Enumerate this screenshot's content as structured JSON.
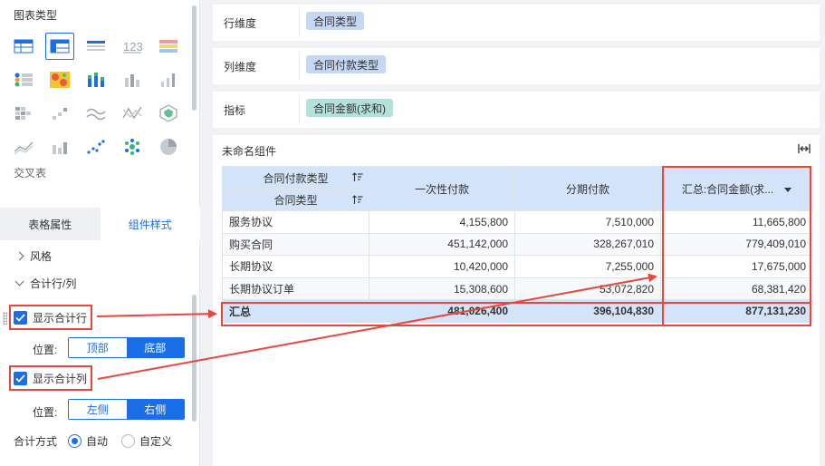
{
  "left_panel": {
    "chart_type_title": "图表类型",
    "chart_icons": [
      {
        "icon": "table-icon",
        "selected": false
      },
      {
        "icon": "crosstab-icon",
        "selected": true
      },
      {
        "icon": "detail-table-icon",
        "selected": false
      },
      {
        "icon": "number-card-icon",
        "text": "123",
        "selected": false
      },
      {
        "icon": "color-table-icon",
        "selected": false
      },
      {
        "icon": "kpi-list-icon",
        "selected": false
      },
      {
        "icon": "heatmap-icon",
        "selected": false
      },
      {
        "icon": "stacked-bar-icon",
        "selected": false
      },
      {
        "icon": "bar-chart-icon",
        "selected": false
      },
      {
        "icon": "column-chart-icon",
        "selected": false
      },
      {
        "icon": "pixel-grid-icon",
        "selected": false
      },
      {
        "icon": "step-line-icon",
        "selected": false
      },
      {
        "icon": "wave-line-icon",
        "selected": false
      },
      {
        "icon": "cross-line-icon",
        "selected": false
      },
      {
        "icon": "radar-icon",
        "selected": false
      },
      {
        "icon": "area-line-icon",
        "selected": false
      },
      {
        "icon": "gantt-bar-icon",
        "selected": false
      },
      {
        "icon": "scatter-icon",
        "selected": false
      },
      {
        "icon": "bubble-icon",
        "selected": false
      },
      {
        "icon": "pie-icon",
        "selected": false
      }
    ],
    "hovered_type_label": "交叉表",
    "tabs": [
      {
        "label": "表格属性",
        "active": false
      },
      {
        "label": "组件样式",
        "active": true
      }
    ],
    "tree": {
      "style_label": "风格",
      "total_label": "合计行/列"
    },
    "show_total_row": {
      "label": "显示合计行",
      "checked": true
    },
    "row_position": {
      "label": "位置:",
      "options": [
        "顶部",
        "底部"
      ],
      "selected": "底部"
    },
    "show_total_col": {
      "label": "显示合计列",
      "checked": true
    },
    "col_position": {
      "label": "位置:",
      "options": [
        "左侧",
        "右侧"
      ],
      "selected": "右侧"
    },
    "total_method": {
      "label": "合计方式",
      "options": [
        "自动",
        "自定义"
      ],
      "selected": "自动"
    }
  },
  "fields": {
    "row_dim": {
      "label": "行维度",
      "chip": "合同类型"
    },
    "col_dim": {
      "label": "列维度",
      "chip": "合同付款类型"
    },
    "metric": {
      "label": "指标",
      "chip": "合同金额(求和)"
    }
  },
  "component": {
    "title": "未命名组件",
    "header": {
      "col_dim_name": "合同付款类型",
      "row_dim_name": "合同类型",
      "columns": [
        "一次性付款",
        "分期付款",
        "汇总:合同金额(求..."
      ]
    },
    "rows": [
      {
        "name": "服务协议",
        "values": [
          "4,155,800",
          "7,510,000",
          "11,665,800"
        ]
      },
      {
        "name": "购买合同",
        "values": [
          "451,142,000",
          "328,267,010",
          "779,409,010"
        ]
      },
      {
        "name": "长期协议",
        "values": [
          "10,420,000",
          "7,255,000",
          "17,675,000"
        ]
      },
      {
        "name": "长期协议订单",
        "values": [
          "15,308,600",
          "53,072,820",
          "68,381,420"
        ]
      }
    ],
    "total": {
      "name": "汇总",
      "values": [
        "481,026,400",
        "396,104,830",
        "877,131,230"
      ]
    }
  },
  "colors": {
    "accent": "#1a6ee8",
    "highlight": "#e8473b",
    "header_bg": "#d3e3f9",
    "chip_blue": "#c4d7f5",
    "chip_green": "#b2e3da"
  }
}
